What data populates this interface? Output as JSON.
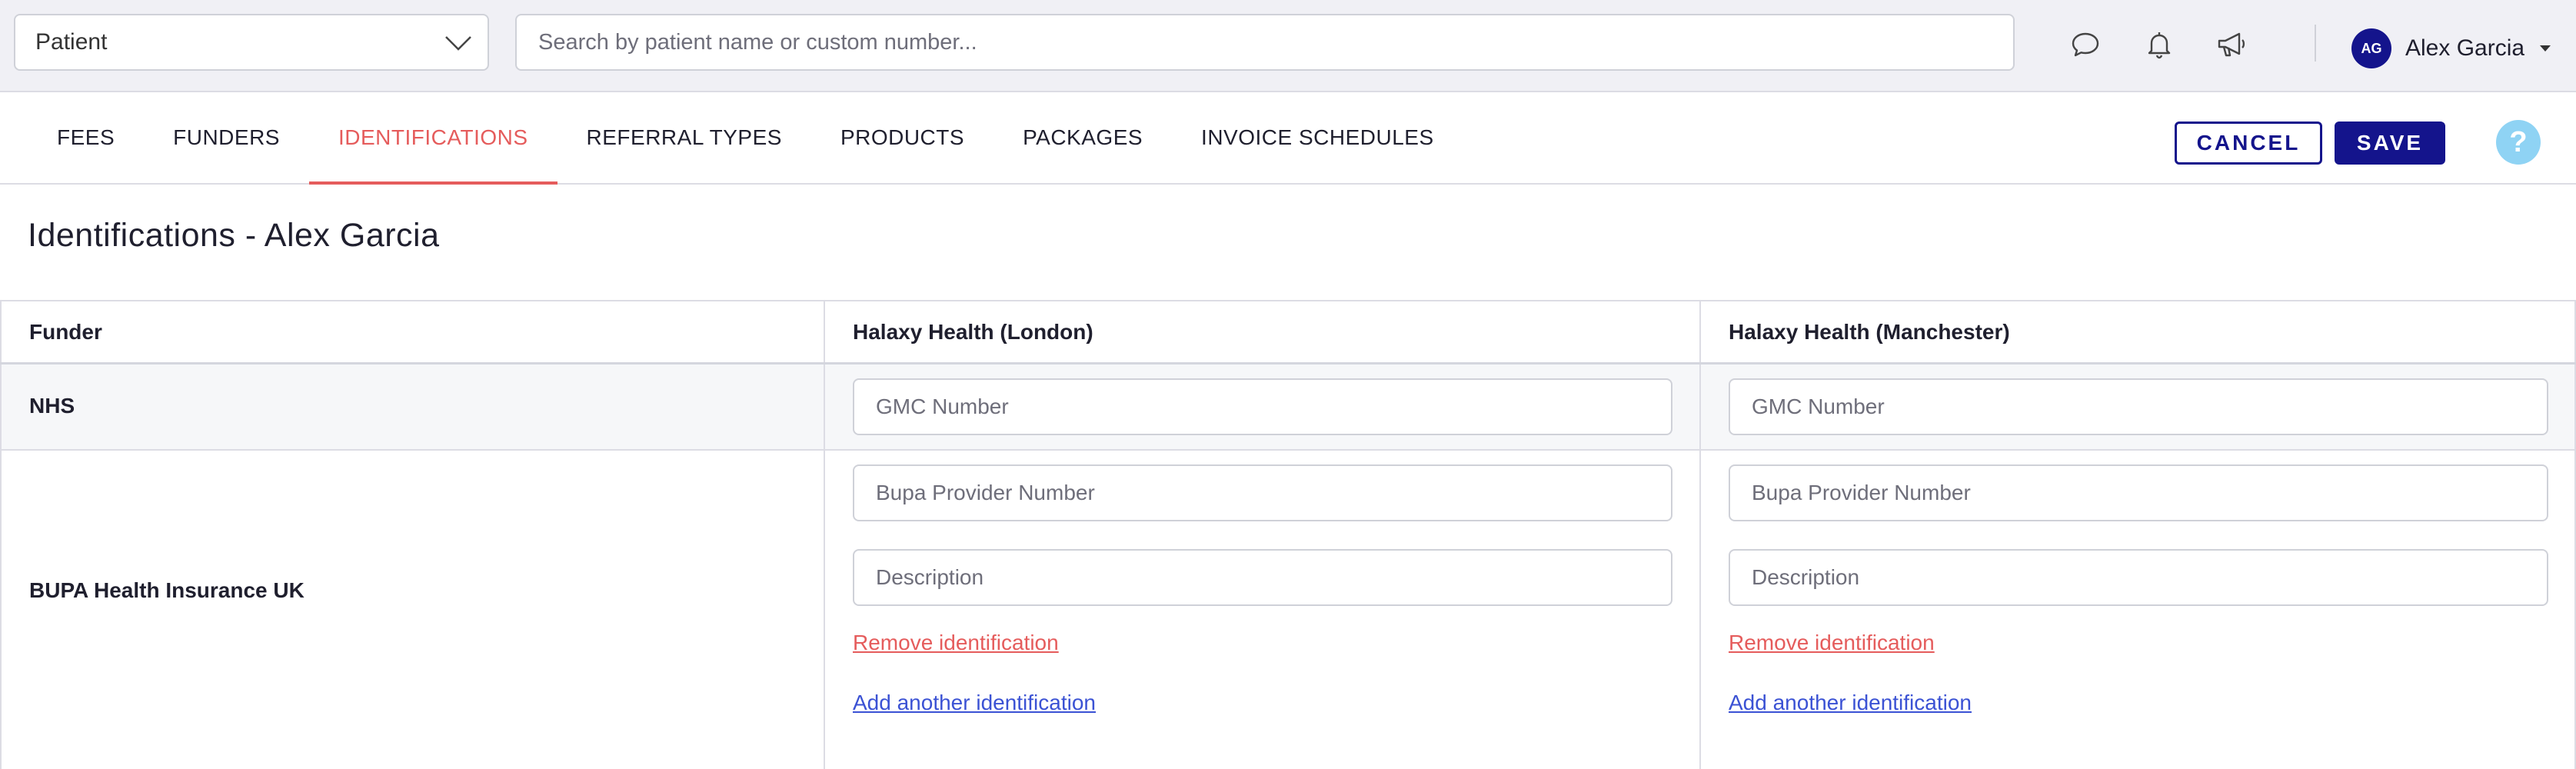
{
  "topbar": {
    "patient_select_value": "Patient",
    "search_placeholder": "Search by patient name or custom number...",
    "user": {
      "initials": "AG",
      "name": "Alex Garcia"
    },
    "icons": [
      "chat-bubble-icon",
      "bell-icon",
      "megaphone-icon"
    ]
  },
  "tabs": [
    {
      "label": "FEES",
      "active": false
    },
    {
      "label": "FUNDERS",
      "active": false
    },
    {
      "label": "IDENTIFICATIONS",
      "active": true
    },
    {
      "label": "REFERRAL TYPES",
      "active": false
    },
    {
      "label": "PRODUCTS",
      "active": false
    },
    {
      "label": "PACKAGES",
      "active": false
    },
    {
      "label": "INVOICE SCHEDULES",
      "active": false
    }
  ],
  "actions": {
    "cancel_label": "CANCEL",
    "save_label": "SAVE",
    "help_label": "?"
  },
  "page": {
    "title": "Identifications - Alex Garcia"
  },
  "table": {
    "headers": [
      "Funder",
      "Halaxy Health (London)",
      "Halaxy Health (Manchester)"
    ],
    "rows": [
      {
        "funder": "NHS",
        "fields": [
          {
            "placeholder": "GMC Number",
            "value": ""
          },
          {
            "placeholder": "GMC Number",
            "value": ""
          }
        ]
      },
      {
        "funder": "BUPA Health Insurance UK",
        "fields": [
          {
            "number_placeholder": "Bupa Provider Number",
            "description_placeholder": "Description"
          },
          {
            "number_placeholder": "Bupa Provider Number",
            "description_placeholder": "Description"
          }
        ],
        "remove_label": "Remove identification",
        "add_label": "Add another identification"
      }
    ]
  },
  "colors": {
    "accent_active_tab": "#e55c5c",
    "primary": "#14148c",
    "link": "#3b52d4",
    "help": "#8fd3f4"
  }
}
